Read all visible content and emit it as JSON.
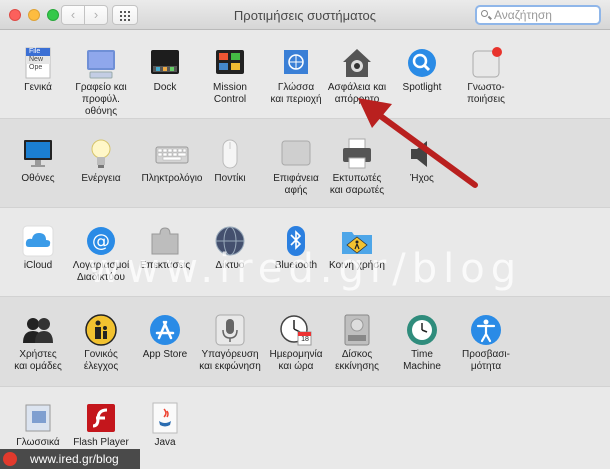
{
  "window": {
    "title": "Προτιμήσεις συστήματος"
  },
  "search": {
    "placeholder": "Αναζήτηση"
  },
  "icons": {
    "nav_back": "‹",
    "nav_forward": "›"
  },
  "sections": [
    [
      {
        "name": "general",
        "label": "Γενικά",
        "file_label": "File",
        "new_label": "New",
        "ope_label": "Ope"
      },
      {
        "name": "desktop",
        "label": "Γραφείο και\nπροφύλ. οθόνης"
      },
      {
        "name": "dock",
        "label": "Dock"
      },
      {
        "name": "mission-control",
        "label": "Mission\nControl"
      },
      {
        "name": "language",
        "label": "Γλώσσα\nκαι περιοχή"
      },
      {
        "name": "security",
        "label": "Ασφάλεια και\nαπόρρητο"
      },
      {
        "name": "spotlight",
        "label": "Spotlight"
      },
      {
        "name": "notifications",
        "label": "Γνωστο-\nποιήσεις"
      }
    ],
    [
      {
        "name": "displays",
        "label": "Οθόνες"
      },
      {
        "name": "energy",
        "label": "Ενέργεια"
      },
      {
        "name": "keyboard",
        "label": "Πληκτρολόγιο"
      },
      {
        "name": "mouse",
        "label": "Ποντίκι"
      },
      {
        "name": "trackpad",
        "label": "Επιφάνεια\nαφής"
      },
      {
        "name": "printers",
        "label": "Εκτυπωτές\nκαι σαρωτές"
      },
      {
        "name": "sound",
        "label": "Ήχος"
      }
    ],
    [
      {
        "name": "icloud",
        "label": "iCloud"
      },
      {
        "name": "internet-accounts",
        "label": "Λογαριασμοί\nΔιαδικτύου"
      },
      {
        "name": "extensions",
        "label": "Επεκτάσεις"
      },
      {
        "name": "network",
        "label": "Δίκτυο"
      },
      {
        "name": "bluetooth",
        "label": "Bluetooth"
      },
      {
        "name": "sharing",
        "label": "Κοινή χρήση"
      }
    ],
    [
      {
        "name": "users",
        "label": "Χρήστες\nκαι ομάδες"
      },
      {
        "name": "parental",
        "label": "Γονικός\nέλεγχος"
      },
      {
        "name": "app-store",
        "label": "App Store"
      },
      {
        "name": "dictation",
        "label": "Υπαγόρευση\nκαι εκφώνηση"
      },
      {
        "name": "date-time",
        "label": "Ημερομηνία\nκαι ώρα",
        "date_number": "18"
      },
      {
        "name": "startup-disk",
        "label": "Δίσκος\nεκκίνησης"
      },
      {
        "name": "time-machine",
        "label": "Time\nMachine"
      },
      {
        "name": "accessibility",
        "label": "Προσβασι-\nμότητα"
      }
    ],
    [
      {
        "name": "language-tools",
        "label": "Γλωσσικά\nΕργαλεία"
      },
      {
        "name": "flash",
        "label": "Flash Player"
      },
      {
        "name": "java",
        "label": "Java"
      }
    ]
  ],
  "watermark": "www.ired.gr/blog",
  "footer": {
    "text": "www.ired.gr/blog"
  }
}
